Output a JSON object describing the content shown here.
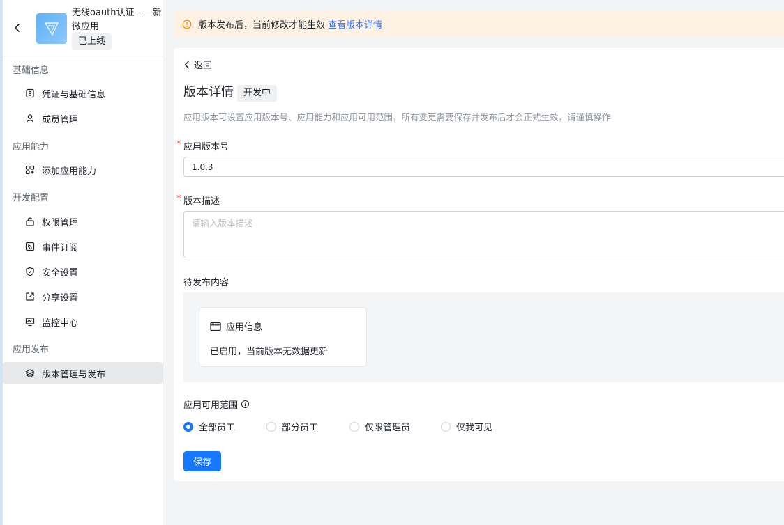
{
  "app": {
    "name": "无线oauth认证——新微应用",
    "status": "已上线"
  },
  "sidebar": {
    "groups": [
      {
        "label": "基础信息"
      },
      {
        "label": "应用能力"
      },
      {
        "label": "开发配置"
      },
      {
        "label": "应用发布"
      }
    ],
    "items": [
      {
        "label": "凭证与基础信息",
        "icon": "credential-icon"
      },
      {
        "label": "成员管理",
        "icon": "user-icon"
      },
      {
        "label": "添加应用能力",
        "icon": "grid-plus-icon"
      },
      {
        "label": "权限管理",
        "icon": "lock-icon"
      },
      {
        "label": "事件订阅",
        "icon": "rss-icon"
      },
      {
        "label": "安全设置",
        "icon": "shield-icon"
      },
      {
        "label": "分享设置",
        "icon": "share-icon"
      },
      {
        "label": "监控中心",
        "icon": "monitor-icon"
      },
      {
        "label": "版本管理与发布",
        "icon": "layers-icon",
        "active": true
      }
    ]
  },
  "banner": {
    "text": "版本发布后，当前修改才能生效",
    "link": "查看版本详情"
  },
  "main": {
    "back_label": "返回",
    "title": "版本详情",
    "status": "开发中",
    "description": "应用版本可设置应用版本号、应用能力和应用可用范围，所有变更需要保存并发布后才会正式生效，请谨慎操作",
    "version_field": {
      "label": "应用版本号",
      "required": true,
      "value": "1.0.3"
    },
    "desc_field": {
      "label": "版本描述",
      "required": true,
      "value": "",
      "placeholder": "请输入版本描述"
    },
    "pending": {
      "label": "待发布内容",
      "card_title": "应用信息",
      "card_text": "已启用，当前版本无数据更新"
    },
    "scope": {
      "label": "应用可用范围",
      "options": [
        {
          "label": "全部员工",
          "checked": true
        },
        {
          "label": "部分员工",
          "checked": false
        },
        {
          "label": "仅限管理员",
          "checked": false
        },
        {
          "label": "仅我可见",
          "checked": false
        }
      ]
    },
    "save_label": "保存"
  },
  "colors": {
    "primary": "#1677ff",
    "link": "#3370ff",
    "warning_bg": "#fdf1e3",
    "warning_icon": "#ff8800",
    "required": "#f54a45"
  }
}
